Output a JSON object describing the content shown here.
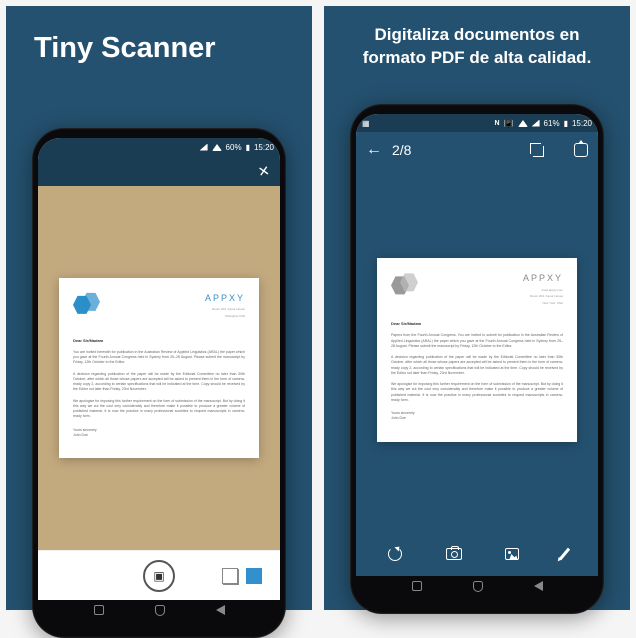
{
  "panel1": {
    "title": "Tiny Scanner",
    "statusbar": {
      "battery": "60%",
      "time": "15:20"
    },
    "doc": {
      "brand": "APPXY",
      "addr1": "Room 204, Kasur House",
      "addr2": "Shanghai CHN",
      "salutation": "Dear Sir/Madam",
      "p1": "You are invited herewith for publication in the Australian Review of Applied Linguistics (ARAL) the paper which you gave at the Fourth Annual Congress held in Sydney from 25–28 August. Please submit the manuscript by Friday, 12th October to the Editor.",
      "p2": "A decision regarding publication of the paper will be made by the Editorial Committee no later than 30th October, after which all those whose papers are accepted will be asked to present them in the form of camera-ready copy 2, according to certain specifications that will be indicated at the time. Copy should be received by the Editor not later than Friday, 23rd November.",
      "p3": "We apologise for imposing this further requirement on the form of submission of the manuscript. But by doing it this way we cut the cost very considerably and therefore make it possible to produce a greater volume of published material. It is now the practice in many professional societies to request manuscripts in camera-ready form.",
      "closing": "Yours sincerely",
      "name": "John Doe"
    }
  },
  "panel2": {
    "title": "Digitaliza documentos en formato PDF de alta calidad.",
    "statusbar": {
      "battery": "61%",
      "time": "15:20",
      "nfc": "N"
    },
    "topbar": {
      "page": "2/8"
    },
    "doc": {
      "brand": "APPXY",
      "addr1": "www.appxy.com",
      "addr2": "Room 204, Kasur House",
      "addr3": "New York, USA",
      "salutation": "Dear Sir/Madam",
      "p1": "Papers from the Fourth Annual Congress. You are invited to submit for publication in the Australian Review of Applied Linguistics (ARAL) the paper which you gave at the Fourth Annual Congress held in Sydney from 25–28 August. Please submit the manuscript by Friday, 12th October to the Editor.",
      "p2": "A decision regarding publication of the paper will be made by the Editorial Committee no later than 30th October, after which all those whose papers are accepted will be asked to present them in the form of camera-ready copy 2, according to certain specifications that will be indicated at the time. Copy should be received by the Editor not later than Friday, 23rd November.",
      "p3": "We apologise for imposing this further requirement on the form of submission of the manuscript. But by doing it this way we cut the cost very considerably and therefore make it possible to produce a greater volume of published material. It is now the practice in many professional societies to request manuscripts in camera-ready form.",
      "closing": "Yours sincerely",
      "name": "John Doe"
    }
  }
}
